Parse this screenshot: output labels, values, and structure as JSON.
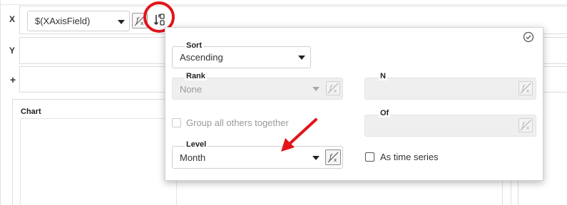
{
  "axis_rows": {
    "x_label": "X",
    "x_field_value": "$(XAxisField)",
    "y_label": "Y",
    "add_label": "+"
  },
  "chart_section": {
    "label": "Chart"
  },
  "sort_popup": {
    "sort": {
      "label": "Sort",
      "value": "Ascending"
    },
    "rank": {
      "label": "Rank",
      "value": "None"
    },
    "n": {
      "label": "N",
      "value": ""
    },
    "of": {
      "label": "Of",
      "value": ""
    },
    "group_others": {
      "label": "Group all others together",
      "checked": false
    },
    "level": {
      "label": "Level",
      "value": "Month"
    },
    "time_series": {
      "label": "As time series",
      "checked": false
    }
  },
  "icons": {
    "sort_icon": "sort-options-icon",
    "fx_icon": "formula-fx-icon",
    "close_icon": "check-circle-icon"
  },
  "colors": {
    "highlight_circle": "#e2141a",
    "arrow": "#e2141a"
  }
}
